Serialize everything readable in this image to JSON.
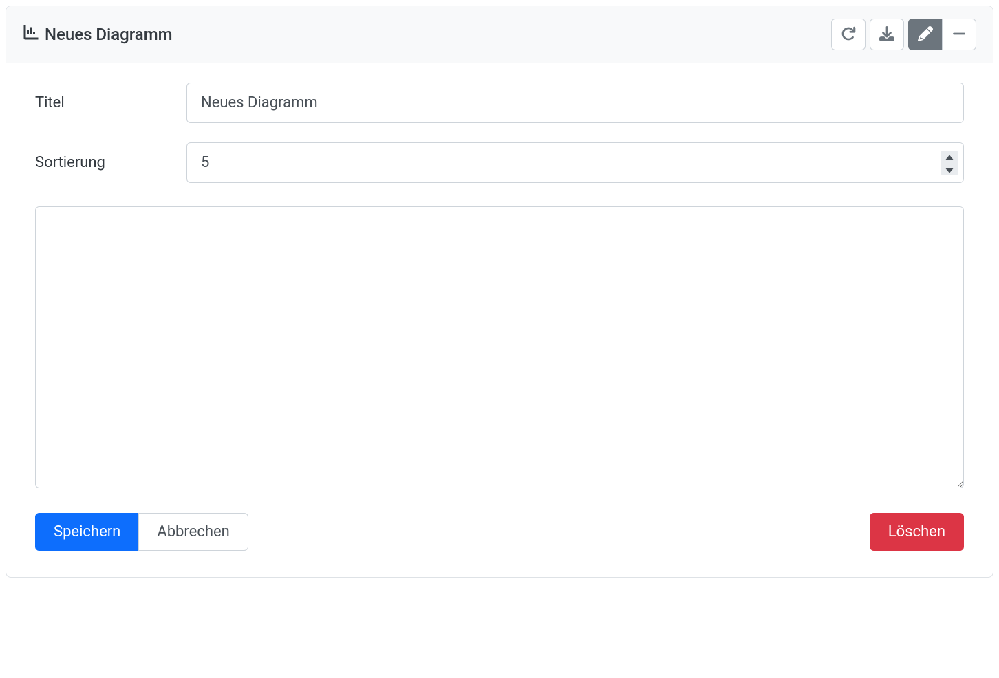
{
  "header": {
    "title": "Neues Diagramm"
  },
  "form": {
    "titleLabel": "Titel",
    "titleValue": "Neues Diagramm",
    "sortLabel": "Sortierung",
    "sortValue": "5",
    "textareaValue": ""
  },
  "buttons": {
    "save": "Speichern",
    "cancel": "Abbrechen",
    "delete": "Löschen"
  }
}
